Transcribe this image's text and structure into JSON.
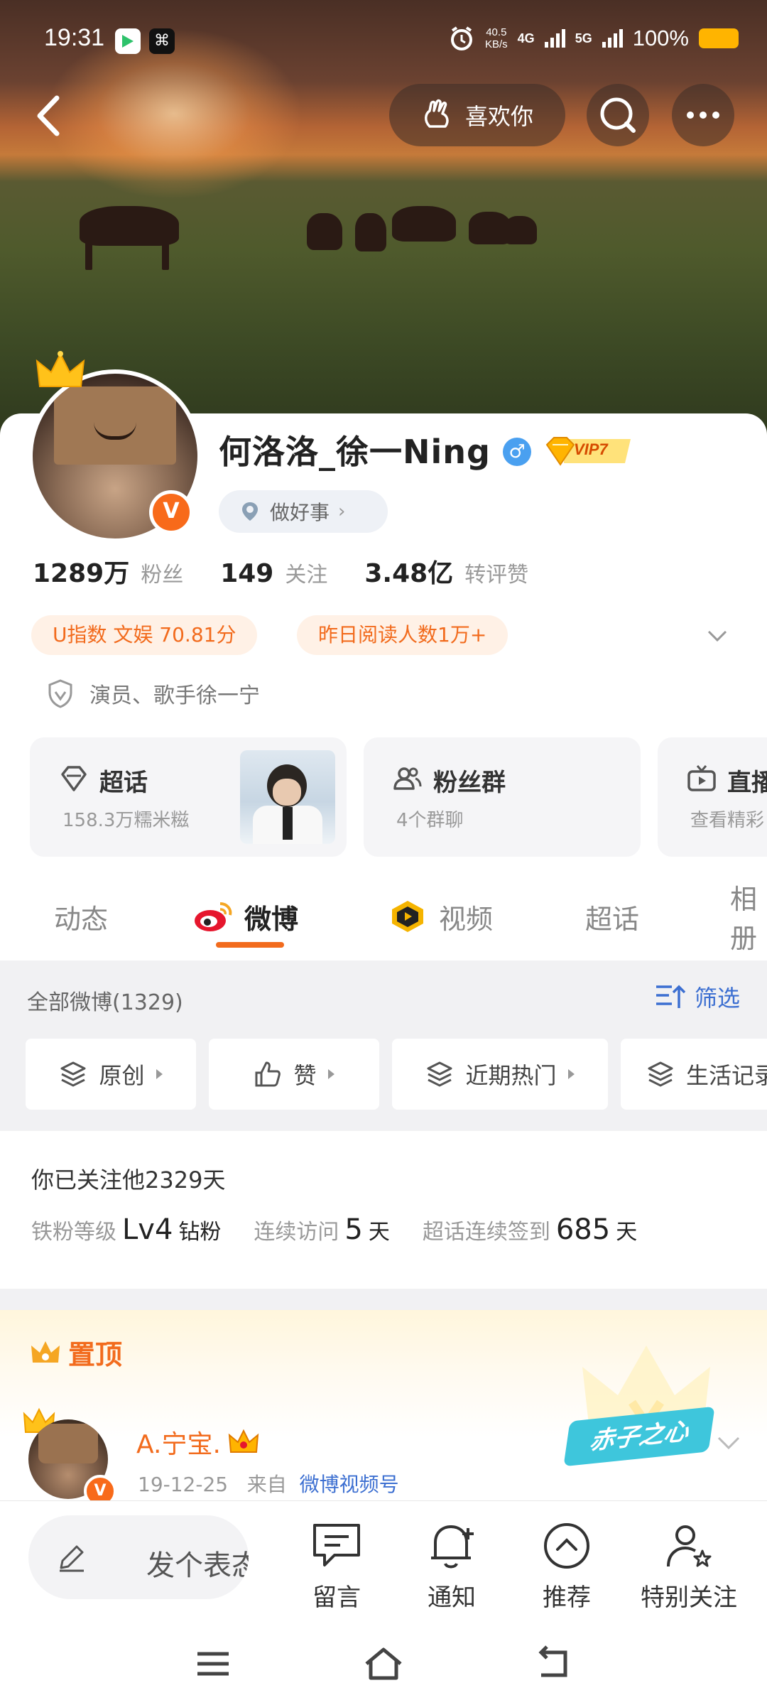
{
  "status_bar": {
    "time": "19:31",
    "net_speed_value": "40.5",
    "net_speed_unit": "KB/s",
    "signal1": "4G",
    "signal2": "5G",
    "battery": "100%",
    "battery_color": "#ffb400"
  },
  "header": {
    "like_button": "喜欢你"
  },
  "profile": {
    "name": "何洛洛_徐一Ning",
    "gender_icon": "♂",
    "vip_label": "VIP7",
    "verified_badge": "V",
    "good_deed": "做好事",
    "stats": [
      {
        "value": "1289万",
        "label": "粉丝"
      },
      {
        "value": "149",
        "label": "关注"
      },
      {
        "value": "3.48亿",
        "label": "转评赞"
      }
    ],
    "pills": {
      "u_index": "U指数 文娱 70.81分",
      "reads": "昨日阅读人数1万+"
    },
    "description": "演员、歌手徐一宁"
  },
  "features": [
    {
      "title": "超话",
      "subtitle": "158.3万糯米糍"
    },
    {
      "title": "粉丝群",
      "subtitle": "4个群聊"
    },
    {
      "title": "直播",
      "subtitle": "查看精彩"
    }
  ],
  "tabs": [
    "动态",
    "微博",
    "视频",
    "超话",
    "相册"
  ],
  "filter": {
    "all_label": "全部微博(1329)",
    "filter_label": "筛选",
    "chips": [
      "原创",
      "赞",
      "近期热门",
      "生活记录"
    ]
  },
  "follow": {
    "days_text": "你已关注他2329天",
    "fan_level_label": "铁粉等级",
    "fan_level_value": "Lv4",
    "fan_level_suffix": "钻粉",
    "visit_label": "连续访问",
    "visit_value": "5",
    "visit_unit": "天",
    "checkin_label": "超话连续签到",
    "checkin_value": "685",
    "checkin_unit": "天"
  },
  "pinned": {
    "label": "置顶",
    "sticker": "赤子之心",
    "post": {
      "author": "A.宁宝.",
      "date": "19-12-25",
      "from_label": "来自",
      "source": "微博视频号"
    }
  },
  "toolbar": {
    "compose_placeholder": "发个表态",
    "items": [
      "留言",
      "通知",
      "推荐",
      "特别关注"
    ]
  },
  "colors": {
    "accent": "#f26b1d",
    "link": "#3c6fd1",
    "vip_gold": "#ffc21a"
  }
}
